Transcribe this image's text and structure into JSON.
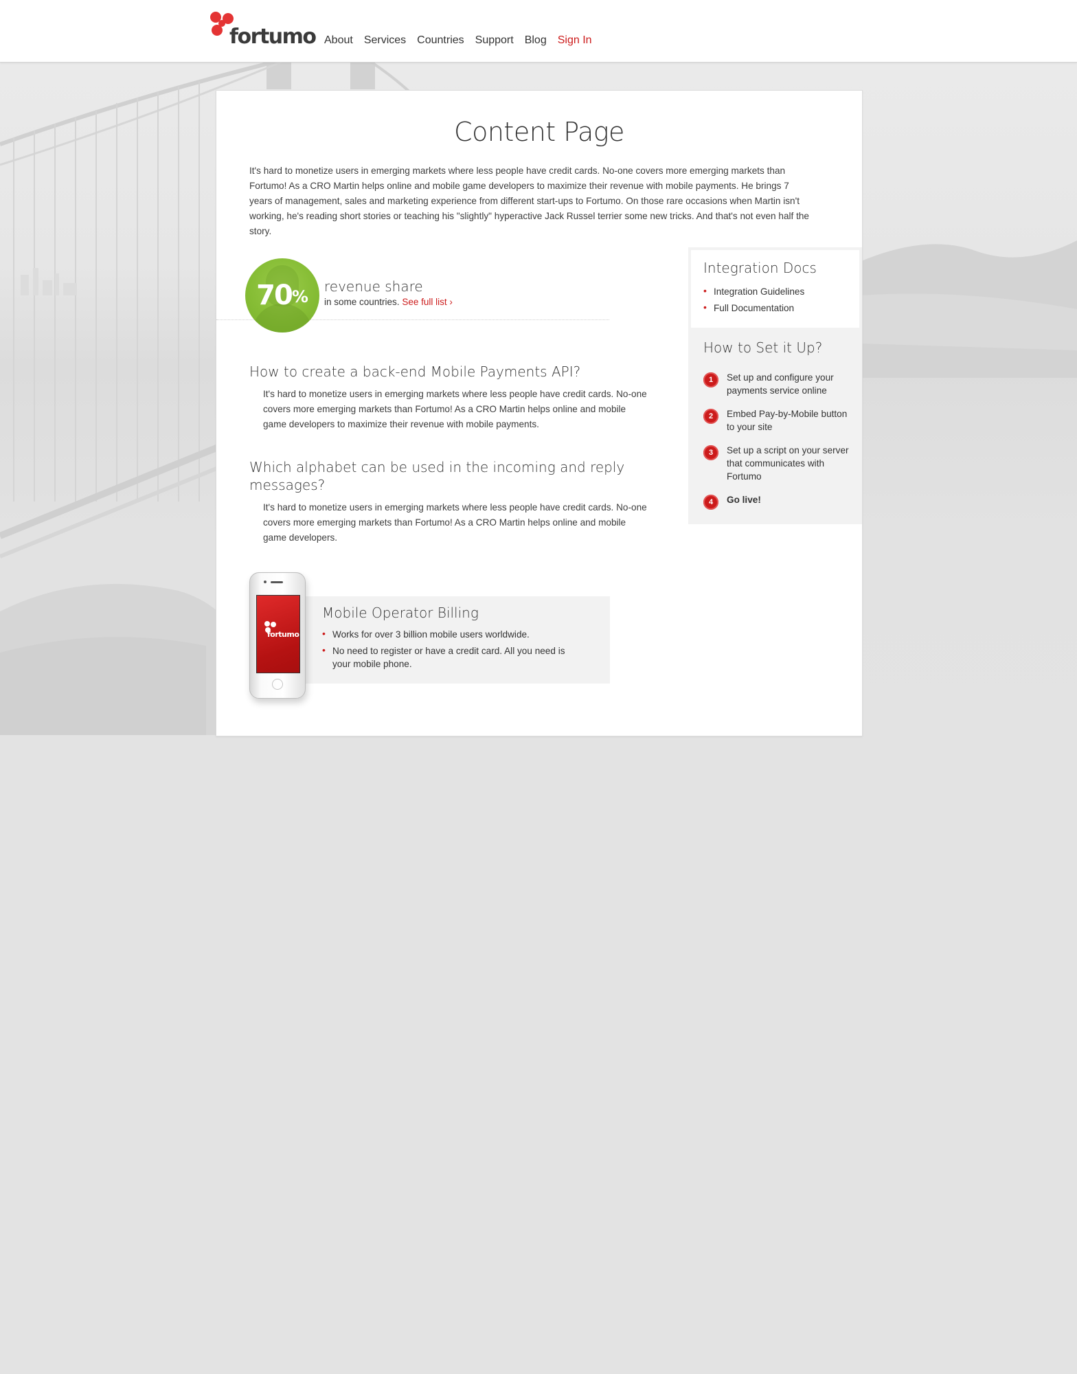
{
  "header": {
    "logo_text": "fortumo",
    "nav": [
      {
        "label": "About"
      },
      {
        "label": "Services"
      },
      {
        "label": "Countries"
      },
      {
        "label": "Support"
      },
      {
        "label": "Blog"
      },
      {
        "label": "Sign In"
      }
    ]
  },
  "main": {
    "title": "Content Page",
    "intro": "It's hard to monetize users in emerging markets where less people have credit cards. No-one covers more emerging markets than Fortumo! As a CRO Martin helps online and mobile game developers to maximize their revenue with mobile payments. He brings 7 years of management, sales and marketing experience from different start-ups to Fortumo. On those rare occasions when Martin isn't working, he's reading short stories or teaching his \"slightly\" hyperactive Jack Russel terrier some new tricks. And that's not even half the story.",
    "revenue": {
      "number": "70",
      "percent": "%",
      "title": "revenue share",
      "subtitle": "in some countries. ",
      "link": "See full list ›"
    },
    "faq": [
      {
        "question": "How to create a back-end Mobile Payments API?",
        "answer": "It's hard to monetize users in emerging markets where less people have credit cards. No-one covers more emerging markets than Fortumo! As a CRO Martin helps online and mobile game developers to maximize their revenue with mobile payments."
      },
      {
        "question": "Which alphabet can be used in the incoming and reply messages?",
        "answer": "It's hard to monetize users in emerging markets where less people have credit cards. No-one covers more emerging markets than Fortumo! As a CRO Martin helps online and mobile game developers."
      }
    ],
    "mobile_billing": {
      "title": "Mobile Operator Billing",
      "phone_logo": "fortumo",
      "items": [
        "Works for over 3 billion mobile users worldwide.",
        "No need to register or have a credit card. All you need is your mobile phone."
      ]
    }
  },
  "sidebar": {
    "docs_title": "Integration Docs",
    "docs_links": [
      "Integration Guidelines",
      "Full Documentation"
    ],
    "setup_title": "How to Set it Up?",
    "steps": [
      {
        "num": "1",
        "text": "Set up and configure your payments service online"
      },
      {
        "num": "2",
        "text": "Embed Pay-by-Mobile button to your site"
      },
      {
        "num": "3",
        "text": "Set up a script on your server that communicates with Fortumo"
      },
      {
        "num": "4",
        "text": "Go live!"
      }
    ]
  },
  "colors": {
    "accent": "#cc1b1b",
    "badge_green": "#86bd35",
    "page_bg": "#e3e3e3",
    "panel_bg": "#f2f2f2"
  }
}
